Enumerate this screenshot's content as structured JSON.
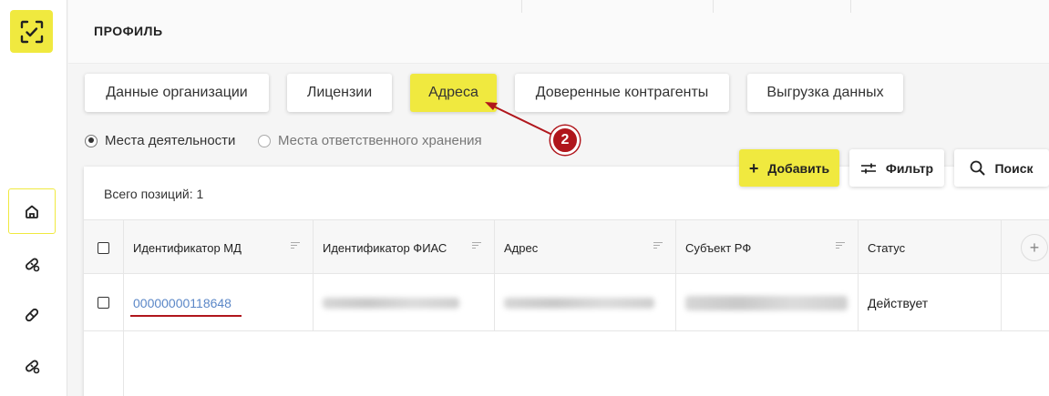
{
  "header": {
    "title": "ПРОФИЛЬ"
  },
  "sidebar": {
    "logo_icon": "scan-check-icon",
    "items": [
      {
        "name": "home",
        "icon": "home-icon",
        "active": true
      },
      {
        "name": "pills",
        "icon": "pill-icon",
        "active": false
      },
      {
        "name": "capsule",
        "icon": "capsule-icon",
        "active": false
      },
      {
        "name": "pills-2",
        "icon": "pill-icon",
        "active": false
      }
    ]
  },
  "tabs": [
    {
      "label": "Данные организации",
      "active": false
    },
    {
      "label": "Лицензии",
      "active": false
    },
    {
      "label": "Адреса",
      "active": true
    },
    {
      "label": "Доверенные контрагенты",
      "active": false
    },
    {
      "label": "Выгрузка данных",
      "active": false
    }
  ],
  "radios": [
    {
      "label": "Места деятельности",
      "checked": true
    },
    {
      "label": "Места ответственного хранения",
      "checked": false
    }
  ],
  "annotation": {
    "number": "2",
    "color": "#b0161c"
  },
  "actions": {
    "add": "Добавить",
    "filter": "Фильтр",
    "search": "Поиск"
  },
  "table": {
    "total": "Всего позиций: 1",
    "columns": [
      "Идентификатор МД",
      "Идентификатор ФИАС",
      "Адрес",
      "Субъект РФ",
      "Статус"
    ],
    "rows": [
      {
        "id": "00000000118648",
        "status": "Действует"
      }
    ]
  },
  "colors": {
    "accent": "#f0e93f",
    "link": "#5b87c7",
    "annotation": "#b0161c"
  }
}
